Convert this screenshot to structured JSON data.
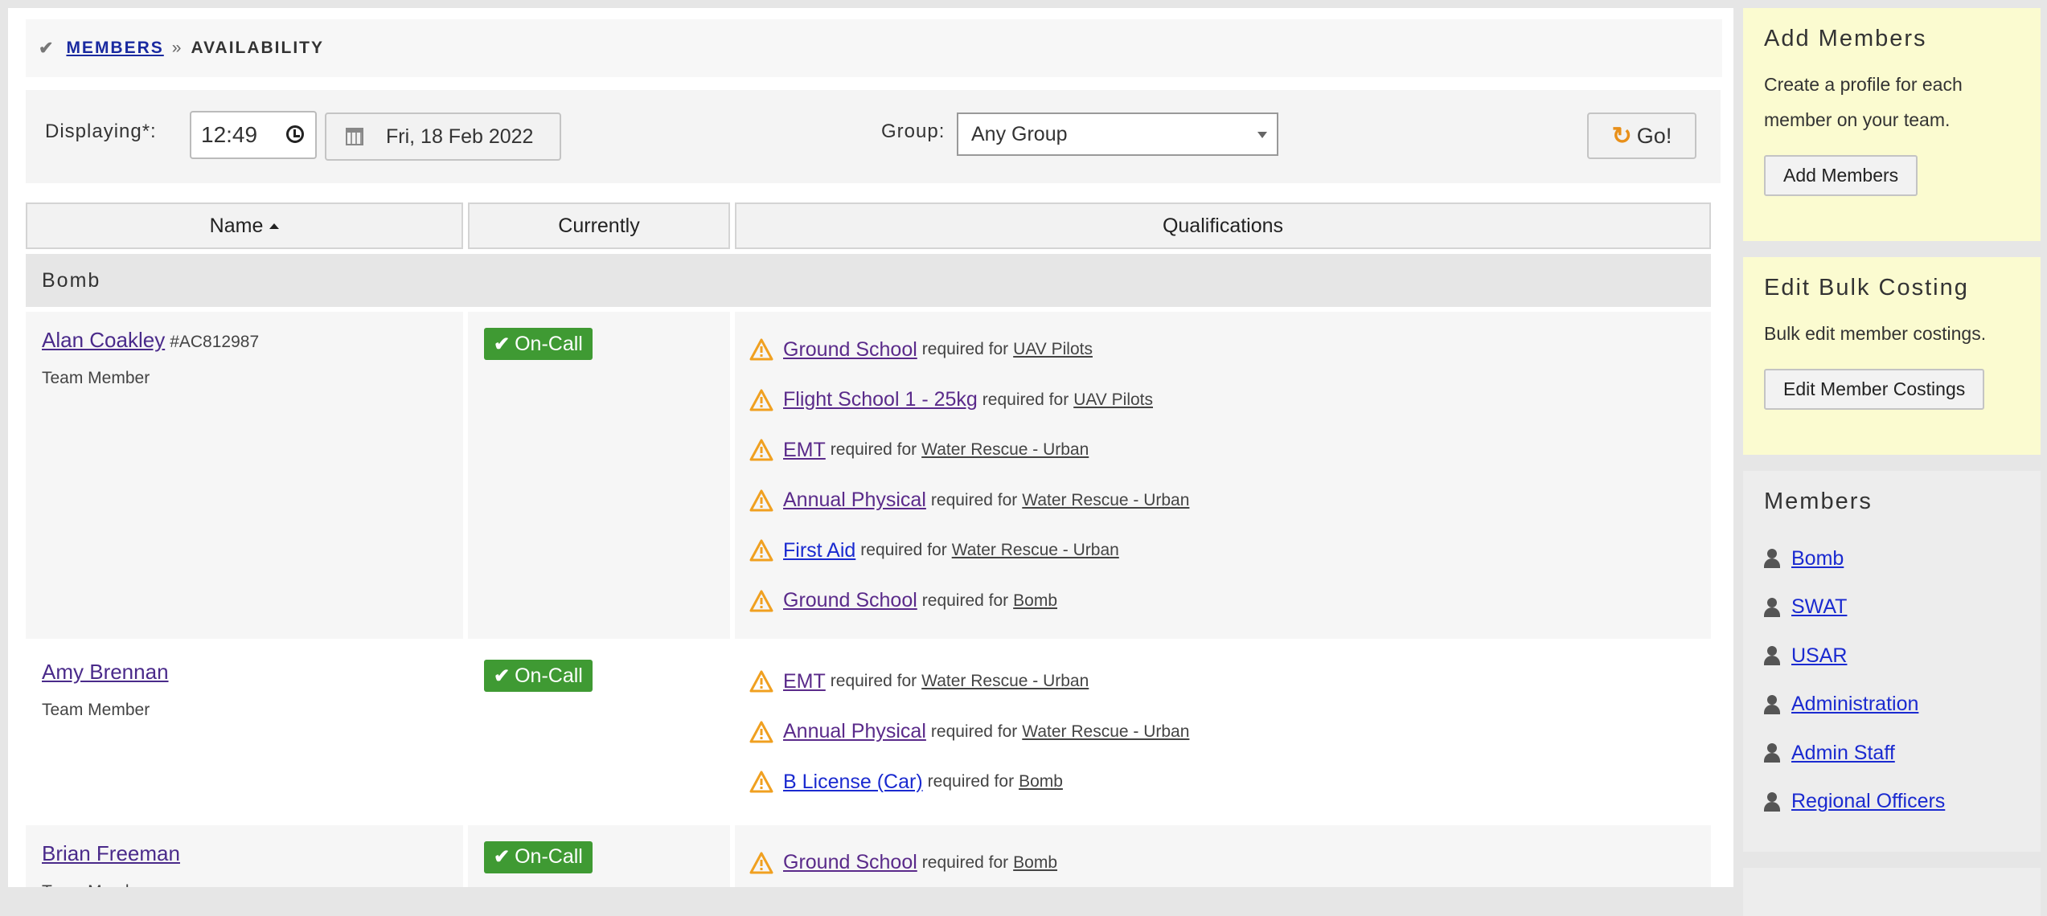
{
  "breadcrumb": {
    "parent": "MEMBERS",
    "separator": "»",
    "current": "AVAILABILITY"
  },
  "filters": {
    "displaying_label": "Displaying*:",
    "time": "12:49",
    "date": "Fri, 18 Feb 2022",
    "group_label": "Group:",
    "group_value": "Any Group",
    "go_label": "Go!"
  },
  "table": {
    "headers": {
      "name": "Name",
      "currently": "Currently",
      "qualifications": "Qualifications"
    },
    "group": "Bomb",
    "required_for": "required for",
    "rows": [
      {
        "name": "Alan Coakley",
        "id": "#AC812987",
        "role": "Team Member",
        "status": "On-Call",
        "quals": [
          {
            "name": "Ground School",
            "group": "UAV Pilots"
          },
          {
            "name": "Flight School 1 - 25kg",
            "group": "UAV Pilots"
          },
          {
            "name": "EMT",
            "group": "Water Rescue - Urban"
          },
          {
            "name": "Annual Physical",
            "group": "Water Rescue - Urban"
          },
          {
            "name": "First Aid",
            "group": "Water Rescue - Urban"
          },
          {
            "name": "Ground School",
            "group": "Bomb"
          }
        ]
      },
      {
        "name": "Amy Brennan",
        "role": "Team Member",
        "status": "On-Call",
        "quals": [
          {
            "name": "EMT",
            "group": "Water Rescue - Urban"
          },
          {
            "name": "Annual Physical",
            "group": "Water Rescue - Urban"
          },
          {
            "name": "B License (Car)",
            "group": "Bomb"
          }
        ]
      },
      {
        "name": "Brian Freeman",
        "role": "Team Member",
        "status": "On-Call",
        "quals": [
          {
            "name": "Ground School",
            "group": "Bomb"
          }
        ]
      }
    ]
  },
  "sidebar": {
    "add_members": {
      "title": "Add Members",
      "text": "Create a profile for each member on your team.",
      "button": "Add Members"
    },
    "bulk_costing": {
      "title": "Edit Bulk Costing",
      "text": "Bulk edit member costings.",
      "button": "Edit Member Costings"
    },
    "members": {
      "title": "Members",
      "items": [
        "Bomb",
        "SWAT",
        "USAR",
        "Administration",
        "Admin Staff",
        "Regional Officers"
      ]
    }
  },
  "colors": {
    "oncall": "#3f9a33",
    "warning": "#f0a020",
    "link": "#1a2ad0",
    "sidebar_yellow": "#fbfbd0"
  },
  "icons": [
    "check-icon",
    "clock-icon",
    "calendar-icon",
    "refresh-icon",
    "sort-asc-icon",
    "warning-icon",
    "person-icon"
  ]
}
